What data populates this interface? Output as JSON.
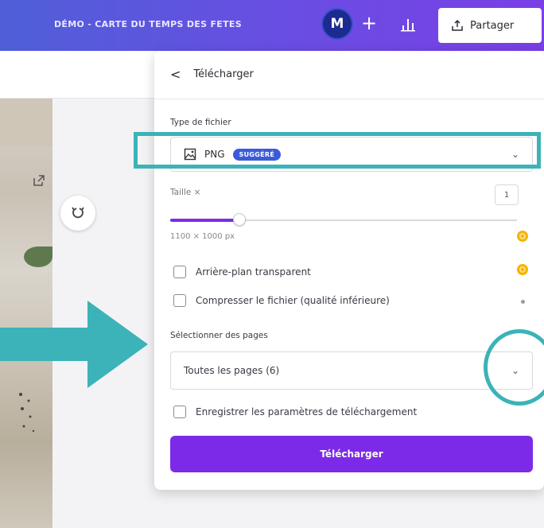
{
  "topbar": {
    "doc_title": "DÉMO - CARTE DU TEMPS DES FETES",
    "avatar_initial": "M",
    "plus_label": "+",
    "share_label": "Partager"
  },
  "panel": {
    "back_label": "<",
    "title": "Télécharger",
    "file_type_label": "Type de fichier",
    "file_type_value": "PNG",
    "file_type_badge": "SUGGÉRÉ",
    "size_label": "Taille ×",
    "size_value": "1",
    "slider_fraction": 0.2,
    "dimensions": "1100 × 1000 px",
    "options": [
      {
        "label": "Arrière-plan transparent",
        "checked": false,
        "premium": true
      },
      {
        "label": "Compresser le fichier (qualité inférieure)",
        "checked": false,
        "premium": false
      }
    ],
    "select_pages_label": "Sélectionner des pages",
    "select_pages_value": "Toutes les pages (6)",
    "save_settings_label": "Enregistrer les paramètres de téléchargement",
    "download_button": "Télécharger"
  },
  "colors": {
    "accent": "#7d2ae8",
    "annotation": "#3bb3b8",
    "badge": "#3b5bdb",
    "premium": "#f5b400"
  }
}
